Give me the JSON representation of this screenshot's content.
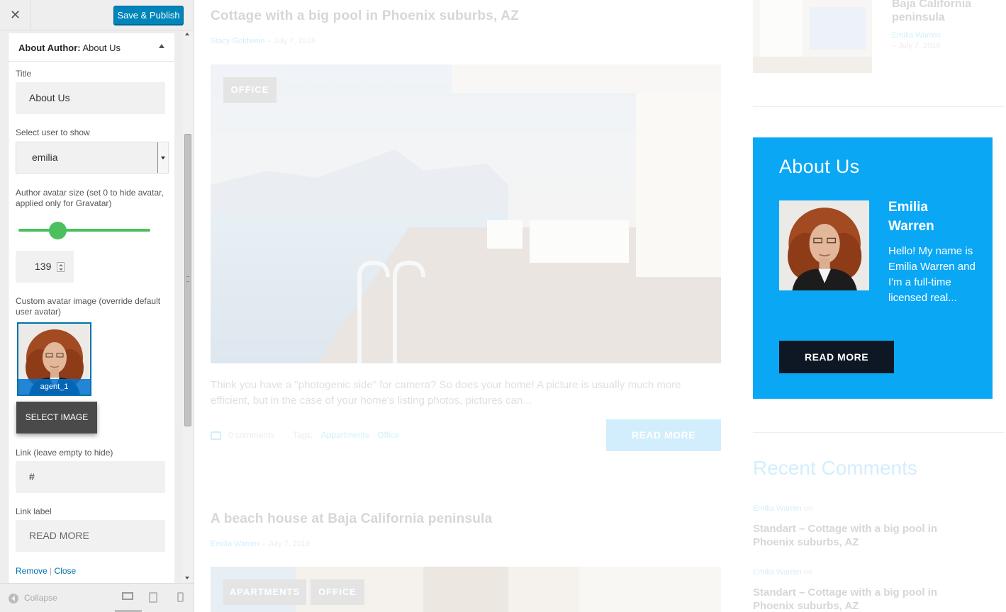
{
  "customizer": {
    "close_label": "✕",
    "publish_label": "Save & Publish",
    "widget": {
      "title_prefix": "About Author:",
      "title_suffix": "About Us",
      "title_label": "Title",
      "title_value": "About Us",
      "user_label": "Select user to show",
      "user_value": "emilia",
      "avatar_size_label": "Author avatar size (set 0 to hide avatar, applied only for Gravatar)",
      "avatar_size_fraction": 0.3,
      "avatar_size_value": "139",
      "custom_avatar_label": "Custom avatar image (override default user avatar)",
      "avatar_filename": "agent_1",
      "select_image_label": "SELECT IMAGE",
      "link_label": "Link (leave empty to hide)",
      "link_value": "#",
      "link_text_label": "Link label",
      "link_text_value": "READ MORE",
      "remove_label": "Remove",
      "separator": "|",
      "close_link_label": "Close"
    },
    "footer": {
      "collapse_label": "Collapse",
      "devices": [
        "desktop-icon",
        "tablet-icon",
        "mobile-icon"
      ]
    }
  },
  "preview": {
    "post1": {
      "title": "Cottage with a big pool in Phoenix suburbs, AZ",
      "author": "Stacy Goldwein",
      "dash": "–",
      "date": "July 7, 2016",
      "badge": "OFFICE",
      "excerpt": "Think you have a \"photogenic side\" for camera? So does your home! A picture is usually much more efficient, but in the case of your home's listing photos, pictures can...",
      "comments": "0 comments",
      "tags_label": "Tags:",
      "tags": [
        "Appartments",
        "Office"
      ],
      "read_more": "READ MORE"
    },
    "post2": {
      "title": "A beach house at Baja California peninsula",
      "author": "Emilia Warren",
      "dash": "–",
      "date": "July 7, 2016",
      "badges": [
        "APARTMENTS",
        "OFFICE"
      ]
    },
    "top_widget": {
      "title": "Baja California peninsula",
      "author": "Emilia Warren",
      "date": "– July 7, 2016"
    },
    "about": {
      "title": "About Us",
      "name": "Emilia Warren",
      "bio": "Hello! My name is Emilia Warren and I'm a full-time licensed real...",
      "read_more": "READ MORE",
      "bg_color": "#0aa7f5"
    },
    "recent_comments": {
      "title": "Recent Comments",
      "items": [
        {
          "author": "Emilia Warren",
          "on": "on",
          "title": "Standart – Cottage with a big pool in Phoenix suburbs, AZ"
        },
        {
          "author": "Emilia Warren",
          "on": "on",
          "title": "Standart – Cottage with a big pool in Phoenix suburbs, AZ"
        }
      ]
    }
  }
}
